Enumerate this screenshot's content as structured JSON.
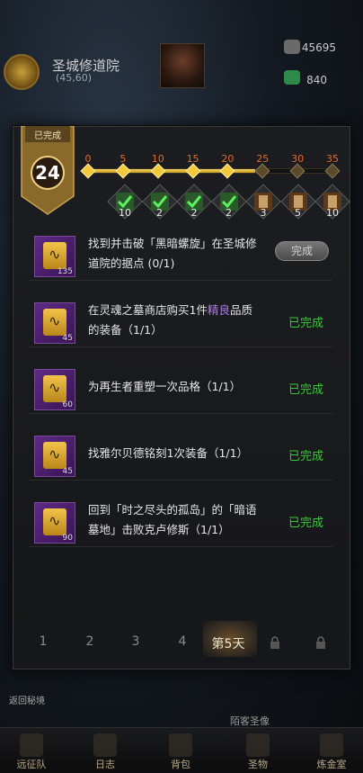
{
  "header": {
    "location_name": "圣城修道院",
    "location_coords": "(45,60)",
    "level_text": "",
    "resource_1": "45695",
    "resource_2": "840"
  },
  "panel": {
    "banner_title": "已完成",
    "banner_value": "24",
    "progress_ticks": [
      "0",
      "5",
      "10",
      "15",
      "20",
      "25",
      "30",
      "35"
    ],
    "progress_current": 24,
    "progress_max": 35,
    "rewards": [
      {
        "count": "10",
        "claimed": true
      },
      {
        "count": "2",
        "claimed": true
      },
      {
        "count": "2",
        "claimed": true
      },
      {
        "count": "2",
        "claimed": true
      },
      {
        "count": "3",
        "claimed": false
      },
      {
        "count": "5",
        "claimed": false
      },
      {
        "count": "10",
        "claimed": false
      }
    ]
  },
  "tasks": [
    {
      "icon_number": "135",
      "text_a": "找到并击破「黑暗螺旋」在圣城修",
      "text_b": "道院的据点 (0/1)",
      "status": "完成",
      "status_type": "button"
    },
    {
      "icon_number": "45",
      "text_pre": "在灵魂之墓商店购买1件",
      "text_highlight": "精良",
      "text_post": "品质",
      "text_b": "的装备（1/1）",
      "status": "已完成",
      "status_type": "done"
    },
    {
      "icon_number": "60",
      "text_a": "为再生者重塑一次品格（1/1）",
      "status": "已完成",
      "status_type": "done"
    },
    {
      "icon_number": "45",
      "text_a": "找雅尔贝德铭刻1次装备（1/1）",
      "status": "已完成",
      "status_type": "done"
    },
    {
      "icon_number": "90",
      "text_a": "回到「时之尽头的孤岛」的「暗语",
      "text_b": "墓地」击败克卢修斯（1/1）",
      "status": "已完成",
      "status_type": "done"
    }
  ],
  "days": [
    "1",
    "2",
    "3",
    "4",
    "第5天"
  ],
  "map": {
    "return_label": "返回秘境",
    "stranger_label": "陌客圣像"
  },
  "bottom_nav": [
    "远征队",
    "日志",
    "背包",
    "圣物",
    "炼金室"
  ],
  "colors": {
    "done_green": "#3cc73a",
    "progress_gold": "#f4c83b",
    "tick_orange": "#e36b2a",
    "quality_purple": "#b27cf0"
  }
}
